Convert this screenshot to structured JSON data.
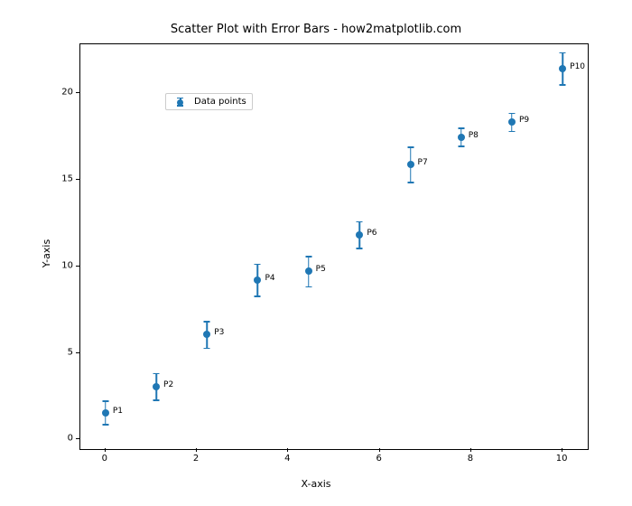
{
  "chart_data": {
    "type": "scatter",
    "title": "Scatter Plot with Error Bars - how2matplotlib.com",
    "xlabel": "X-axis",
    "ylabel": "Y-axis",
    "legend": "Data points",
    "x_ticks": [
      0,
      2,
      4,
      6,
      8,
      10
    ],
    "y_ticks": [
      0,
      5,
      10,
      15,
      20
    ],
    "xlim": [
      -0.55,
      10.55
    ],
    "ylim": [
      -0.55,
      22.8
    ],
    "series": [
      {
        "name": "Data points",
        "points": [
          {
            "x": 0.0,
            "y": 1.55,
            "yerr": 0.7,
            "label": "P1"
          },
          {
            "x": 1.11,
            "y": 3.05,
            "yerr": 0.8,
            "label": "P2"
          },
          {
            "x": 2.22,
            "y": 6.05,
            "yerr": 0.8,
            "label": "P3"
          },
          {
            "x": 3.33,
            "y": 9.2,
            "yerr": 0.95,
            "label": "P4"
          },
          {
            "x": 4.44,
            "y": 9.7,
            "yerr": 0.9,
            "label": "P5"
          },
          {
            "x": 5.56,
            "y": 11.8,
            "yerr": 0.8,
            "label": "P6"
          },
          {
            "x": 6.67,
            "y": 15.85,
            "yerr": 1.05,
            "label": "P7"
          },
          {
            "x": 7.78,
            "y": 17.45,
            "yerr": 0.55,
            "label": "P8"
          },
          {
            "x": 8.89,
            "y": 18.3,
            "yerr": 0.55,
            "label": "P9"
          },
          {
            "x": 10.0,
            "y": 21.4,
            "yerr": 0.95,
            "label": "P10"
          }
        ]
      }
    ],
    "color": "#1f77b4"
  }
}
